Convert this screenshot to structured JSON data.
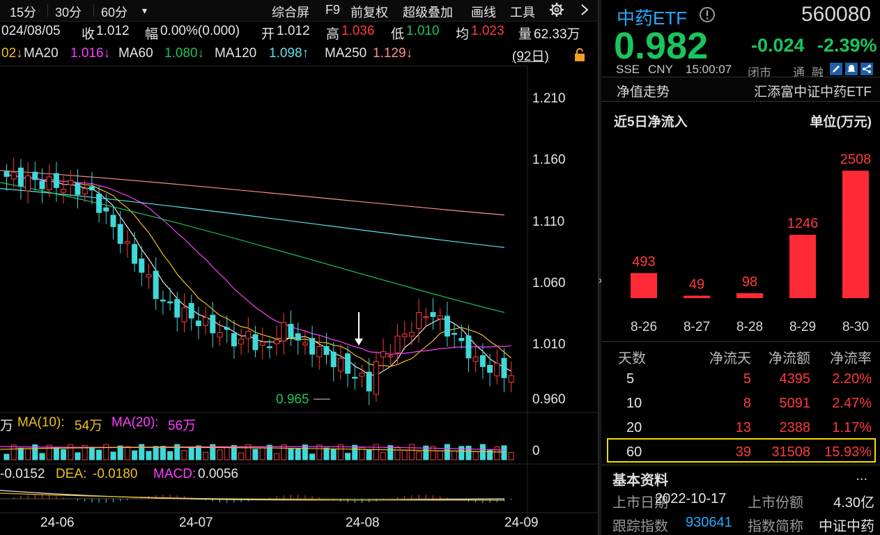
{
  "toolbar": {
    "periods": [
      "15分",
      "30分",
      "60分"
    ],
    "period_dropdown": "▾",
    "actions": [
      "综合屏",
      "F9",
      "前复权",
      "超级叠加",
      "画线",
      "工具"
    ]
  },
  "info": {
    "date": "024/08/05",
    "close_label": "收",
    "close": "1.012",
    "range_label": "幅",
    "range": "0.00%(0.000)",
    "open_label": "开",
    "open": "1.012",
    "high_label": "高",
    "high": "1.036",
    "low_label": "低",
    "low": "1.010",
    "avg_label": "均",
    "avg": "1.023",
    "vol_label": "量",
    "vol": "62.33万"
  },
  "ma_legend": {
    "ma5_tail": "02↓",
    "ma20_label": "MA20",
    "ma20": "1.016↓",
    "ma60_label": "MA60",
    "ma60": "1.080↓",
    "ma120_label": "MA120",
    "ma120": "1.098↑",
    "ma250_label": "MA250",
    "ma250": "1.129↓",
    "days": "(92日)"
  },
  "price_axis": [
    "1.210",
    "1.160",
    "1.110",
    "1.060",
    "1.010",
    "0.960"
  ],
  "min_marker": "0.965",
  "volume_legend": {
    "prefix": "万",
    "ma10_label": "MA(10):",
    "ma10": "54万",
    "ma20_label": "MA(20):",
    "ma20": "56万",
    "axis_zero": "0"
  },
  "macd_legend": {
    "dif": "-0.0152",
    "dea_label": "DEA:",
    "dea": "-0.0180",
    "macd_label": "MACD:",
    "macd": "0.0056"
  },
  "date_axis": [
    "24-06",
    "24-07",
    "24-08",
    "24-09"
  ],
  "quote": {
    "name": "中药ETF",
    "code": "560080",
    "price": "0.982",
    "change": "-0.024",
    "change_pct": "-2.39%",
    "exchange": "SSE",
    "currency": "CNY",
    "time": "15:00:07",
    "status": "闭市",
    "tong": "通",
    "rong": "融"
  },
  "nav_section": {
    "title": "净值走势",
    "fund_name": "汇添富中证中药ETF"
  },
  "net_flow": {
    "title": "近5日净流入",
    "unit": "单位(万元)",
    "bar_color": "#ff2a35",
    "categories": [
      "8-26",
      "8-27",
      "8-28",
      "8-29",
      "8-30"
    ],
    "values": [
      493,
      49,
      98,
      1246,
      2508
    ]
  },
  "flow_table": {
    "headers": [
      "天数",
      "净流天",
      "净流额",
      "净流率"
    ],
    "rows": [
      [
        "5",
        "5",
        "4395",
        "2.20%"
      ],
      [
        "10",
        "8",
        "5091",
        "2.47%"
      ],
      [
        "20",
        "13",
        "2388",
        "1.17%"
      ],
      [
        "60",
        "39",
        "31508",
        "15.93%"
      ]
    ],
    "highlight_color": "#f5dc00"
  },
  "basic_info": {
    "title": "基本资料",
    "more": "...",
    "list_date_label": "上市日期",
    "list_date": "2022-10-17",
    "shares_label": "上市份额",
    "shares": "4.30亿",
    "index_label": "跟踪指数",
    "index_code": "930641",
    "index_short_label": "指数简称",
    "index_short": "中证中药"
  },
  "colors": {
    "up": "#ff3b3b",
    "down": "#19c55d",
    "candle_down": "#40d8d8",
    "ma5": "#e8e8e8",
    "ma10": "#f0c020",
    "ma20": "#ff40ff",
    "ma60": "#19c55d",
    "ma120": "#5ee6f0",
    "ma250": "#ff8f8f"
  }
}
